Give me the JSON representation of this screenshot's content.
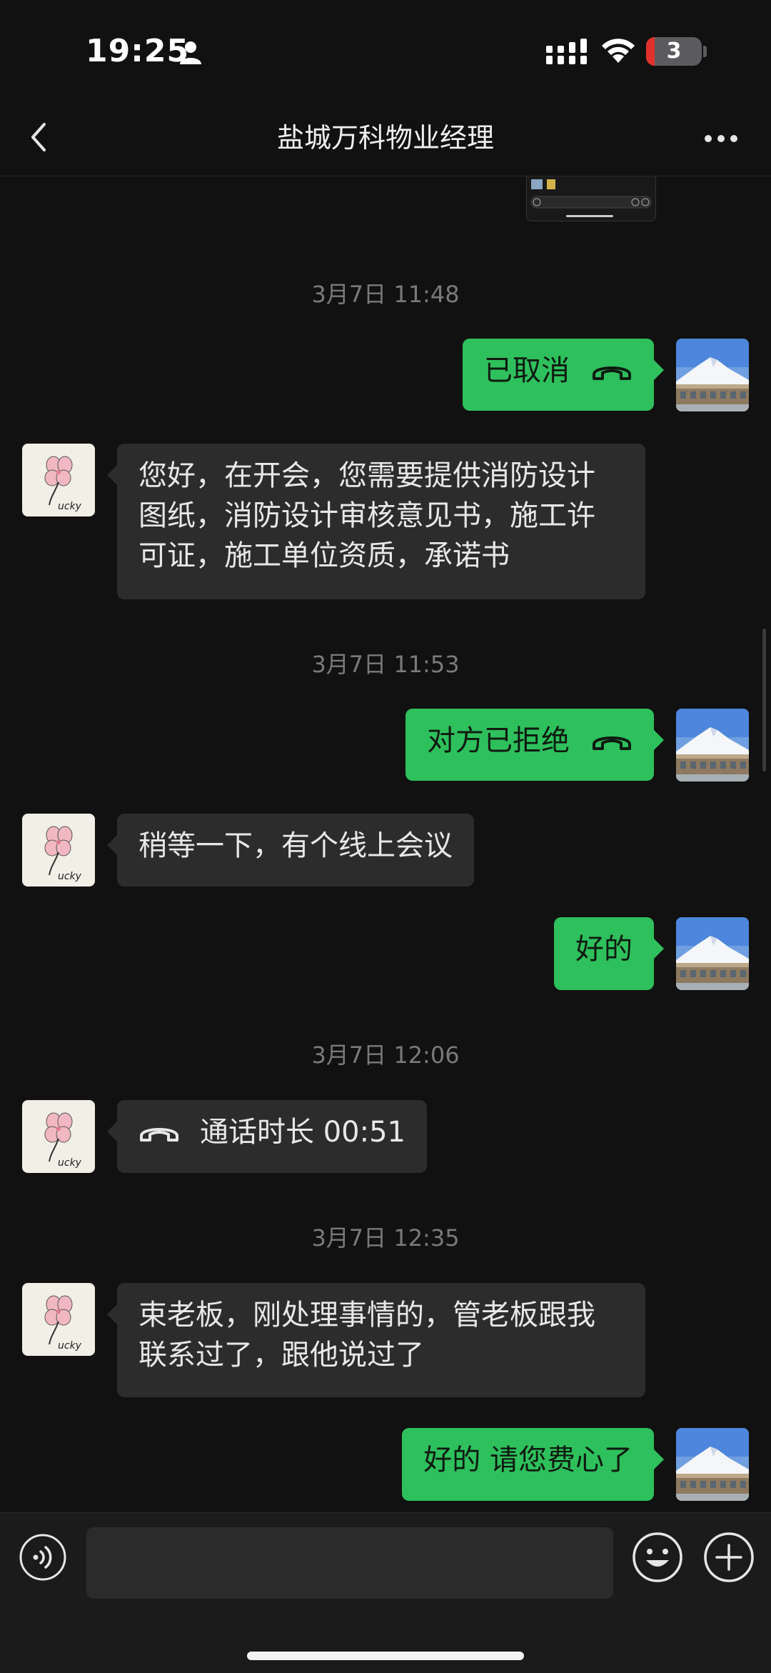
{
  "status_bar": {
    "time": "19:25",
    "battery_level": "3"
  },
  "header": {
    "title": "盐城万科物业经理"
  },
  "messages": [
    {
      "type": "timestamp",
      "text": "3月7日 11:48"
    },
    {
      "type": "call",
      "direction": "out",
      "text": "已取消"
    },
    {
      "type": "text",
      "direction": "in",
      "lines": [
        "您好，在开会，您需要提供消防设计",
        "图纸，消防设计审核意见书，施工许",
        "可证，施工单位资质，承诺书"
      ]
    },
    {
      "type": "timestamp",
      "text": "3月7日 11:53"
    },
    {
      "type": "call",
      "direction": "out",
      "text": "对方已拒绝"
    },
    {
      "type": "text",
      "direction": "in",
      "lines": [
        "稍等一下，有个线上会议"
      ]
    },
    {
      "type": "text",
      "direction": "out",
      "lines": [
        "好的"
      ]
    },
    {
      "type": "timestamp",
      "text": "3月7日 12:06"
    },
    {
      "type": "call",
      "direction": "in",
      "text": "通话时长 00:51"
    },
    {
      "type": "timestamp",
      "text": "3月7日 12:35"
    },
    {
      "type": "text",
      "direction": "in",
      "lines": [
        "束老板，刚处理事情的，管老板跟我",
        "联系过了，跟他说过了"
      ]
    },
    {
      "type": "text",
      "direction": "out",
      "lines": [
        "好的 请您费心了"
      ]
    }
  ],
  "avatars": {
    "contact": "lucky-flower-avatar",
    "contact_text": "ucky",
    "self": "mountain-landscape-avatar"
  },
  "colors": {
    "background": "#111111",
    "bubble_out": "#2ec05c",
    "bubble_in": "#2c2c2c",
    "battery_low": "#e0322b"
  }
}
